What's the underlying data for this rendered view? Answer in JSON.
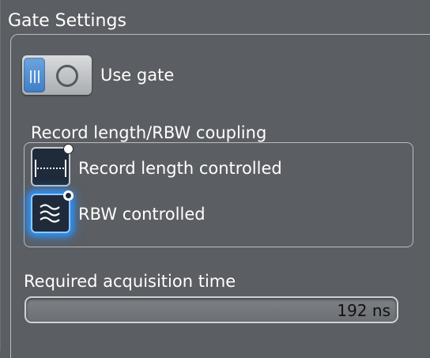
{
  "panel": {
    "title": "Gate Settings"
  },
  "gate": {
    "label": "Use gate",
    "enabled": true,
    "toggle_icon_on": "bars-icon",
    "toggle_icon_off": "ring-icon"
  },
  "coupling": {
    "label": "Record length/RBW coupling",
    "options": [
      {
        "label": "Record length controlled",
        "icon": "record-length-icon",
        "selected": false
      },
      {
        "label": "RBW controlled",
        "icon": "rbw-wave-icon",
        "selected": true
      }
    ]
  },
  "acquisition": {
    "label": "Required acquisition time",
    "value": "192 ns"
  },
  "colors": {
    "background": "#5b5e62",
    "accent": "#3f7fc6",
    "focus_glow": "#2f8df0"
  }
}
